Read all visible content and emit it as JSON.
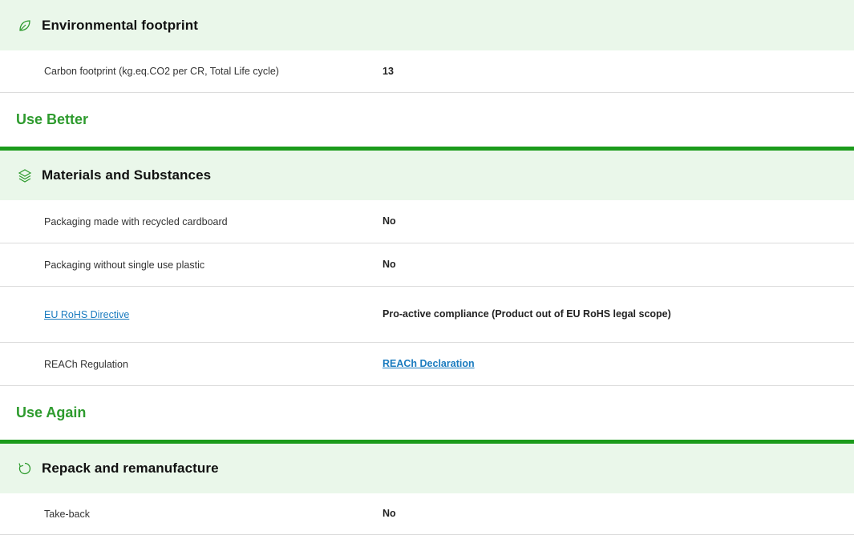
{
  "groups": {
    "environmental": {
      "title": "Environmental footprint",
      "icon": "leaf-icon",
      "rows": [
        {
          "label": "Carbon footprint (kg.eq.CO2 per CR, Total Life cycle)",
          "value": "13"
        }
      ]
    },
    "materials": {
      "title": "Materials and Substances",
      "icon": "layers-icon",
      "rows": [
        {
          "label": "Packaging made with recycled cardboard",
          "value": "No"
        },
        {
          "label": "Packaging without single use plastic",
          "value": "No"
        },
        {
          "label": "EU RoHS Directive",
          "value": "Pro-active compliance (Product out of EU RoHS legal scope)"
        },
        {
          "label": "REACh Regulation",
          "value": "REACh Declaration"
        }
      ]
    },
    "repack": {
      "title": "Repack and remanufacture",
      "icon": "refresh-icon",
      "rows": [
        {
          "label": "Take-back",
          "value": "No"
        }
      ]
    }
  },
  "sections": {
    "use_better": "Use Better",
    "use_again": "Use Again"
  },
  "colors": {
    "accent_green": "#2e9b2e",
    "header_bg": "#eaf7ea",
    "link_blue": "#1a7bbf"
  }
}
